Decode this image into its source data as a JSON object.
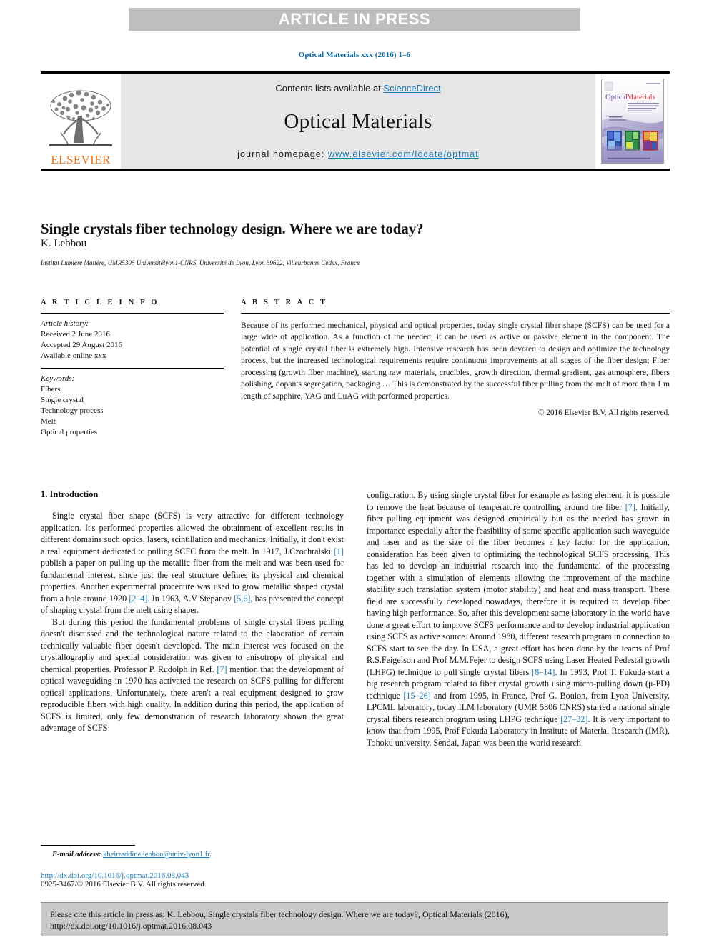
{
  "banner": {
    "text": "ARTICLE IN PRESS"
  },
  "running_head": "Optical Materials xxx (2016) 1–6",
  "masthead": {
    "publisher_name": "ELSEVIER",
    "contents_prefix": "Contents lists available at ",
    "sciencedirect_link": "ScienceDirect",
    "journal_title": "Optical Materials",
    "homepage_prefix": "journal homepage: ",
    "homepage_link": "www.elsevier.com/locate/optmat",
    "cover_title_1": "Optical",
    "cover_title_2": "Materials",
    "accent_orange": "#e87722",
    "link_blue": "#1c7ab5",
    "band_gray": "#e6e6e6"
  },
  "article": {
    "title": "Single crystals fiber technology design. Where we are today?",
    "author": "K. Lebbou",
    "affiliation": "Institut Lumière Matière, UMR5306 Universitélyon1-CNRS, Université de Lyon, Lyon 69622, Villeurbanne Cedex, France"
  },
  "article_info": {
    "heading": "A R T I C L E   I N F O",
    "history_label": "Article history:",
    "history": [
      "Received 2 June 2016",
      "Accepted 29 August 2016",
      "Available online xxx"
    ],
    "keywords_label": "Keywords:",
    "keywords": [
      "Fibers",
      "Single crystal",
      "Technology process",
      "Melt",
      "Optical properties"
    ]
  },
  "abstract": {
    "heading": "A B S T R A C T",
    "text": "Because of its performed mechanical, physical and optical properties, today single crystal fiber shape (SCFS) can be used for a large wide of application. As a function of the needed, it can be used as active or passive element in the component. The potential of single crystal fiber is extremely high. Intensive research has been devoted to design and optimize the technology process, but the increased technological requirements require continuous improvements at all stages of the fiber design; Fiber processing (growth fiber machine), starting raw materials, crucibles, growth direction, thermal gradient, gas atmosphere, fibers polishing, dopants segregation, packaging … This is demonstrated by the successful fiber pulling from the melt of more than 1 m length of sapphire, YAG and LuAG with performed properties.",
    "copyright": "© 2016 Elsevier B.V. All rights reserved."
  },
  "body": {
    "section_title": "1. Introduction",
    "left_paragraphs": [
      {
        "parts": [
          {
            "t": "Single crystal fiber shape (SCFS) is very attractive for different technology application. It's performed properties allowed the obtainment of excellent results in different domains such optics, lasers, scintillation and mechanics. Initially, it don't exist a real equipment dedicated to pulling SCFC from the melt. In 1917, J.Czochralski ",
            "r": false
          },
          {
            "t": "[1]",
            "r": true
          },
          {
            "t": " publish a paper on pulling up the metallic fiber from the melt and was been used for fundamental interest, since just the real structure defines its physical and chemical properties. Another experimental procedure was used to grow metallic shaped crystal from a hole around 1920 ",
            "r": false
          },
          {
            "t": "[2–4]",
            "r": true
          },
          {
            "t": ". In 1963, A.V Stepanov ",
            "r": false
          },
          {
            "t": "[5,6]",
            "r": true
          },
          {
            "t": ", has presented the concept of shaping crystal from the melt using shaper.",
            "r": false
          }
        ]
      },
      {
        "parts": [
          {
            "t": "But during this period the fundamental problems of single crystal fibers pulling doesn't discussed and the technological nature related to the elaboration of certain technically valuable fiber doesn't developed. The main interest was focused on the crystallography and special consideration was given to anisotropy of physical and chemical properties. Professor P. Rudolph in Ref. ",
            "r": false
          },
          {
            "t": "[7]",
            "r": true
          },
          {
            "t": " mention that the development of optical waveguiding in 1970 has activated the research on SCFS pulling for different optical applications. Unfortunately, there aren't a real equipment designed to grow reproducible fibers with high quality. In addition during this period, the application of SCFS is limited, only few demonstration of research laboratory shown the great advantage of SCFS",
            "r": false
          }
        ]
      }
    ],
    "right_paragraphs": [
      {
        "parts": [
          {
            "t": "configuration. By using single crystal fiber for example as lasing element, it is possible to remove the heat because of temperature controlling around the fiber ",
            "r": false
          },
          {
            "t": "[7]",
            "r": true
          },
          {
            "t": ". Initially, fiber pulling equipment was designed empirically but as the needed has grown in importance especially after the feasibility of some specific application such waveguide and laser and as the size of the fiber becomes a key factor for the application, consideration has been given to optimizing the technological SCFS processing. This has led to develop an industrial research into the fundamental of the processing together with a simulation of elements allowing the improvement of the machine stability such translation system (motor stability) and heat and mass transport. These field are successfully developed nowadays, therefore it is required to develop fiber having high performance. So, after this development some laboratory in the world have done a great effort to improve SCFS performance and to develop industrial application using SCFS as active source. Around 1980, different research program in connection to SCFS start to see the day. In USA, a great effort has been done by the teams of Prof R.S.Feigelson and Prof M.M.Fejer to design SCFS using Laser Heated Pedestal growth (LHPG) technique to pull single crystal fibers ",
            "r": false
          },
          {
            "t": "[8–14]",
            "r": true
          },
          {
            "t": ". In 1993, Prof T. Fukuda start a big research program related to fiber crystal growth using micro-pulling down (μ-PD) technique ",
            "r": false
          },
          {
            "t": "[15–26]",
            "r": true
          },
          {
            "t": " and from 1995, in France, Prof G. Boulon, from Lyon University, LPCML laboratory, today ILM laboratory (UMR 5306 CNRS) started a national single crystal fibers research program using LHPG technique ",
            "r": false
          },
          {
            "t": "[27–32]",
            "r": true
          },
          {
            "t": ". It is very important to know that from 1995, Prof Fukuda Laboratory in Institute of Material Research (IMR), Tohoku university, Sendai, Japan was been the world research",
            "r": false
          }
        ]
      }
    ]
  },
  "footnote": {
    "email_label": "E-mail address:",
    "email_address": "kheirreddine.lebbou@univ-lyon1.fr",
    "doi": "http://dx.doi.org/10.1016/j.optmat.2016.08.043",
    "issn": "0925-3467/© 2016 Elsevier B.V. All rights reserved."
  },
  "cite_box": {
    "text": "Please cite this article in press as: K. Lebbou, Single crystals fiber technology design. Where we are today?, Optical Materials (2016), http://dx.doi.org/10.1016/j.optmat.2016.08.043"
  }
}
